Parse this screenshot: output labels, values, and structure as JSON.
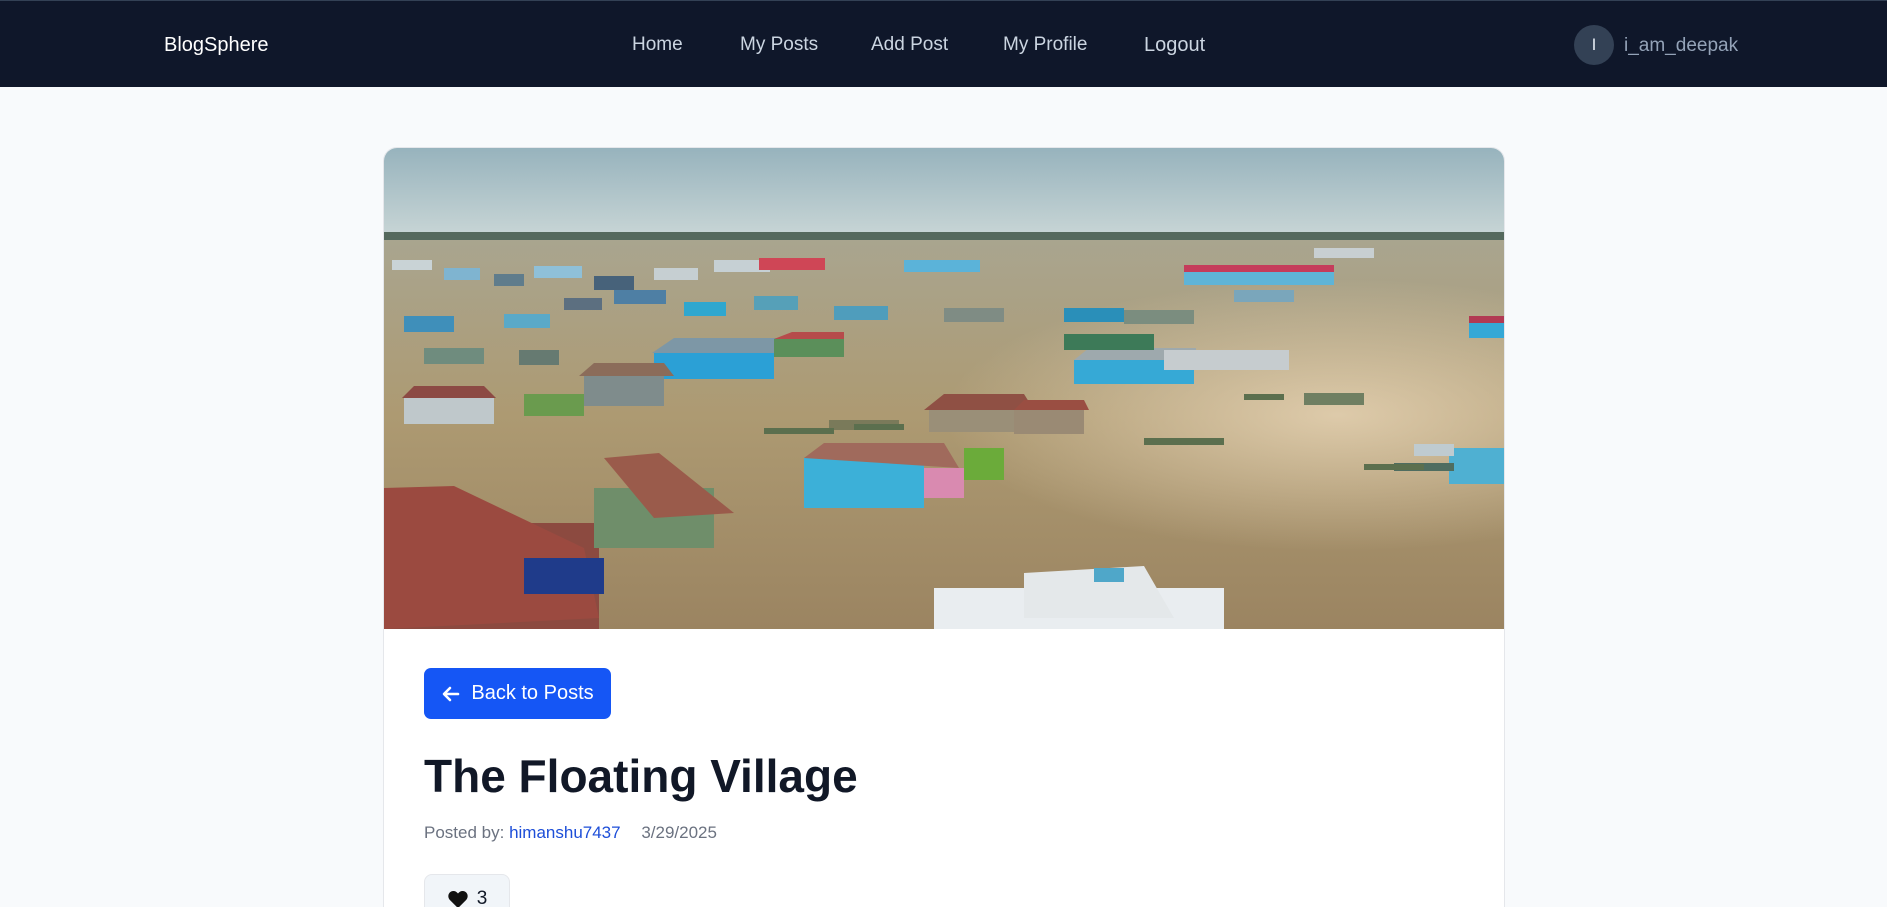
{
  "navbar": {
    "brand": "BlogSphere",
    "links": [
      "Home",
      "My Posts",
      "Add Post",
      "My Profile",
      "Logout"
    ],
    "avatar_initial": "I",
    "username": "i_am_deepak"
  },
  "post": {
    "back_label": "Back to Posts",
    "title": "The Floating Village",
    "posted_by_label": "Posted by:",
    "author": "himanshu7437",
    "date": "3/29/2025",
    "likes": "3",
    "hero_icon": "floating-village-photo"
  },
  "colors": {
    "navbar_bg": "#0f172a",
    "primary": "#1556f5",
    "link": "#1d4ed8"
  }
}
